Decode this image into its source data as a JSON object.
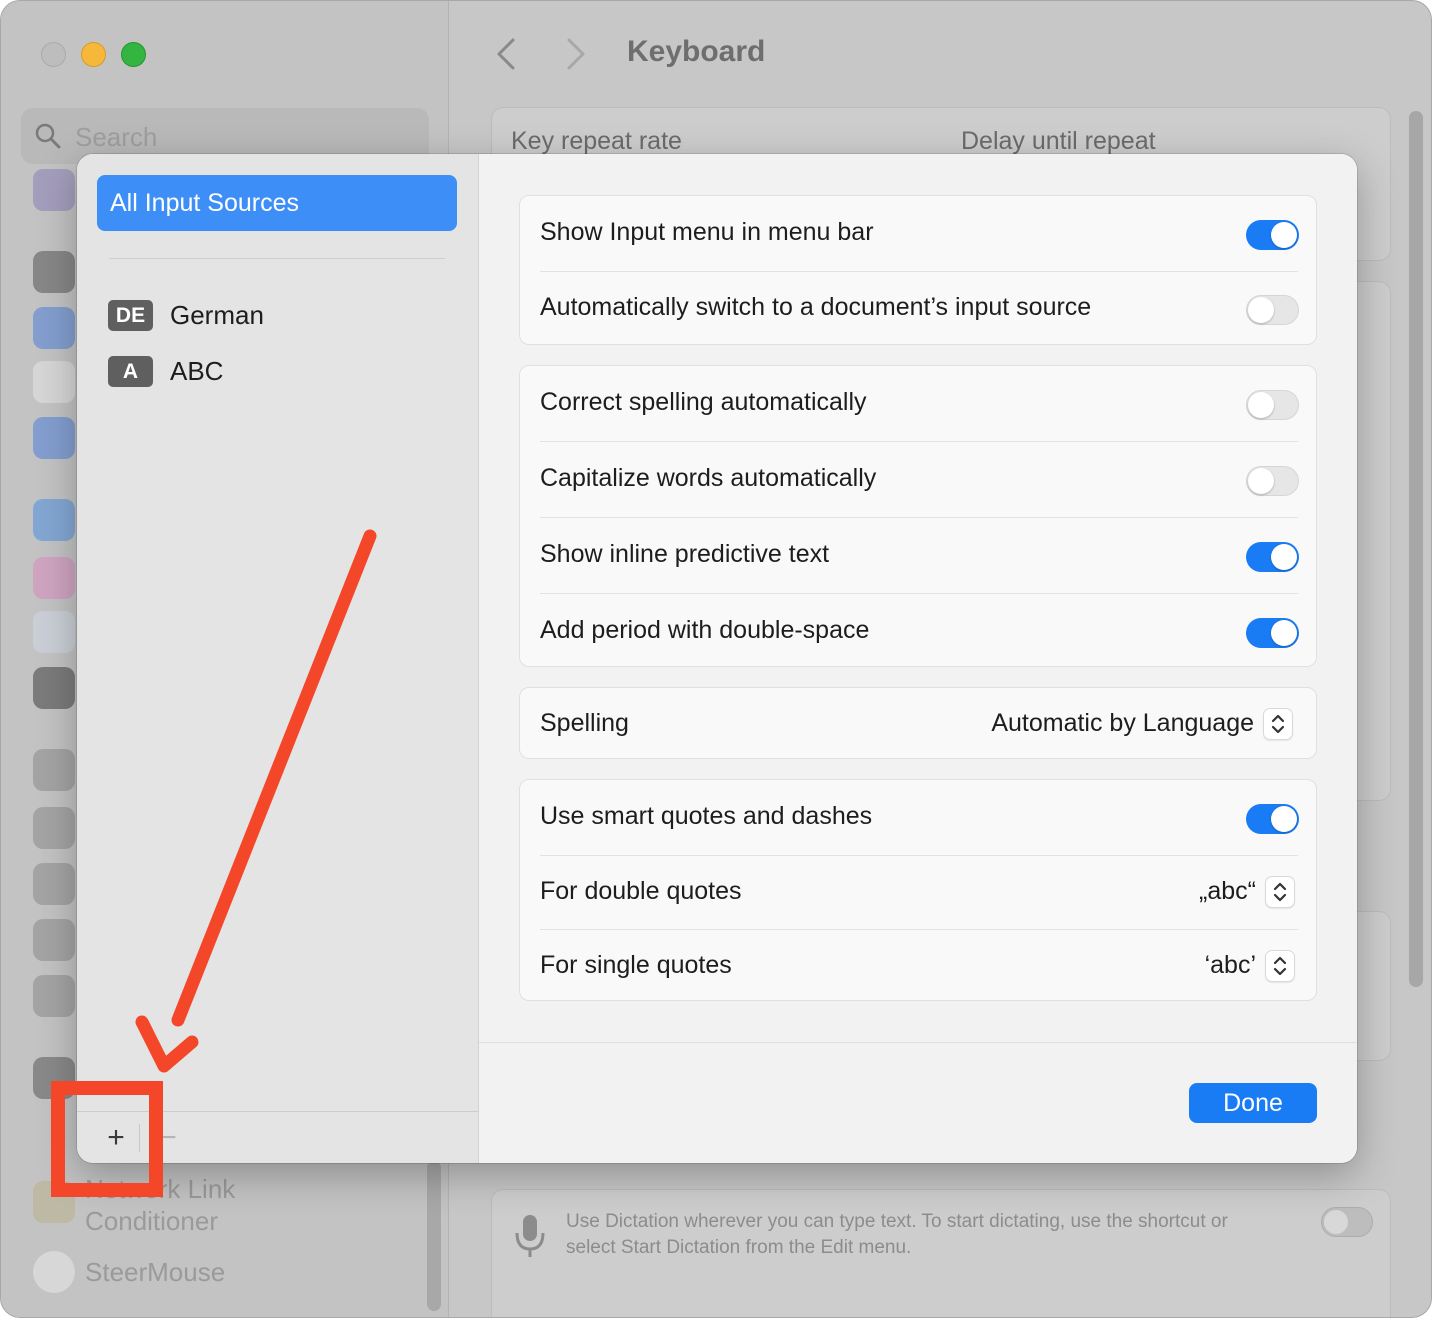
{
  "window": {
    "title": "Keyboard",
    "search_placeholder": "Search"
  },
  "background": {
    "key_repeat_label": "Key repeat rate",
    "delay_label": "Delay until repeat",
    "sidebar_items": [
      {
        "label": "Network Link Conditioner",
        "icon": "network-link-conditioner-icon"
      },
      {
        "label": "SteerMouse",
        "icon": "steermouse-icon"
      }
    ],
    "dictation_text": "Use Dictation wherever you can type text. To start dictating, use the shortcut or select Start Dictation from the Edit menu."
  },
  "sheet": {
    "sidebar": {
      "all_sources": "All Input Sources",
      "sources": [
        {
          "badge": "DE",
          "label": "German"
        },
        {
          "badge": "A",
          "label": "ABC"
        }
      ],
      "add_label": "+",
      "remove_label": "−"
    },
    "groups": {
      "menu": [
        {
          "label": "Show Input menu in menu bar",
          "on": true
        },
        {
          "label": "Automatically switch to a document’s input source",
          "on": false
        }
      ],
      "text": [
        {
          "label": "Correct spelling automatically",
          "on": false
        },
        {
          "label": "Capitalize words automatically",
          "on": false
        },
        {
          "label": "Show inline predictive text",
          "on": true
        },
        {
          "label": "Add period with double-space",
          "on": true
        }
      ],
      "spelling": {
        "label": "Spelling",
        "value": "Automatic by Language"
      },
      "quotes": {
        "smart_label": "Use smart quotes and dashes",
        "smart_on": true,
        "double_label": "For double quotes",
        "double_value": "„abc“",
        "single_label": "For single quotes",
        "single_value": "‘abc’"
      }
    },
    "done_label": "Done"
  },
  "colors": {
    "accent": "#1a7cf4",
    "selection": "#3d8ff7",
    "annotation": "#f4472a"
  }
}
